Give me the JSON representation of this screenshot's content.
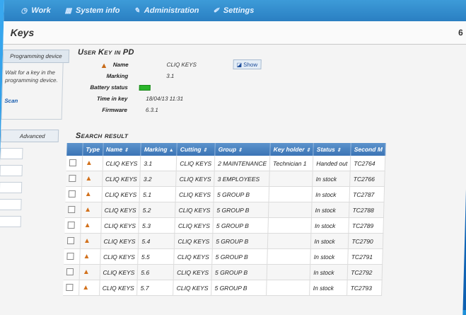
{
  "nav": {
    "items": [
      {
        "icon": "clock-icon",
        "label": "Work"
      },
      {
        "icon": "grid-icon",
        "label": "System info"
      },
      {
        "icon": "wrench-icon",
        "label": "Administration"
      },
      {
        "icon": "pencil-icon",
        "label": "Settings"
      }
    ]
  },
  "page": {
    "title": "Keys",
    "number": "6"
  },
  "left": {
    "programming_tab": "Programming device",
    "programming_text": "Wait for a key in the programming device.",
    "programming_link": "Scan",
    "advanced_tab": "Advanced"
  },
  "user_key": {
    "section_title": "User Key in PD",
    "name_label": "Name",
    "name_value": "CLIQ KEYS",
    "marking_label": "Marking",
    "marking_value": "3.1",
    "battery_label": "Battery status",
    "time_label": "Time in key",
    "time_value": "18/04/13 11:31",
    "firmware_label": "Firmware",
    "firmware_value": "6.3.1",
    "show_button": "Show"
  },
  "search": {
    "section_title": "Search result",
    "columns": [
      "Type",
      "Name",
      "Marking",
      "Cutting",
      "Group",
      "Key holder",
      "Status",
      "Second M"
    ],
    "rows": [
      {
        "name": "CLIQ KEYS",
        "marking": "3.1",
        "cutting": "CLIQ KEYS",
        "group": "2 MAINTENANCE",
        "holder": "Technician 1",
        "status": "Handed out",
        "second": "TC2764"
      },
      {
        "name": "CLIQ KEYS",
        "marking": "3.2",
        "cutting": "CLIQ KEYS",
        "group": "3 EMPLOYEES",
        "holder": "",
        "status": "In stock",
        "second": "TC2766"
      },
      {
        "name": "CLIQ KEYS",
        "marking": "5.1",
        "cutting": "CLIQ KEYS",
        "group": "5 GROUP B",
        "holder": "",
        "status": "In stock",
        "second": "TC2787"
      },
      {
        "name": "CLIQ KEYS",
        "marking": "5.2",
        "cutting": "CLIQ KEYS",
        "group": "5 GROUP B",
        "holder": "",
        "status": "In stock",
        "second": "TC2788"
      },
      {
        "name": "CLIQ KEYS",
        "marking": "5.3",
        "cutting": "CLIQ KEYS",
        "group": "5 GROUP B",
        "holder": "",
        "status": "In stock",
        "second": "TC2789"
      },
      {
        "name": "CLIQ KEYS",
        "marking": "5.4",
        "cutting": "CLIQ KEYS",
        "group": "5 GROUP B",
        "holder": "",
        "status": "In stock",
        "second": "TC2790"
      },
      {
        "name": "CLIQ KEYS",
        "marking": "5.5",
        "cutting": "CLIQ KEYS",
        "group": "5 GROUP B",
        "holder": "",
        "status": "In stock",
        "second": "TC2791"
      },
      {
        "name": "CLIQ KEYS",
        "marking": "5.6",
        "cutting": "CLIQ KEYS",
        "group": "5 GROUP B",
        "holder": "",
        "status": "In stock",
        "second": "TC2792"
      },
      {
        "name": "CLIQ KEYS",
        "marking": "5.7",
        "cutting": "CLIQ KEYS",
        "group": "5 GROUP B",
        "holder": "",
        "status": "In stock",
        "second": "TC2793"
      }
    ]
  },
  "colors": {
    "nav_bg": "#2a7fc2",
    "header_bg": "#3b74b5",
    "battery": "#2bb52b",
    "key_icon": "#d2711c",
    "frame": "#1d8fd8"
  }
}
